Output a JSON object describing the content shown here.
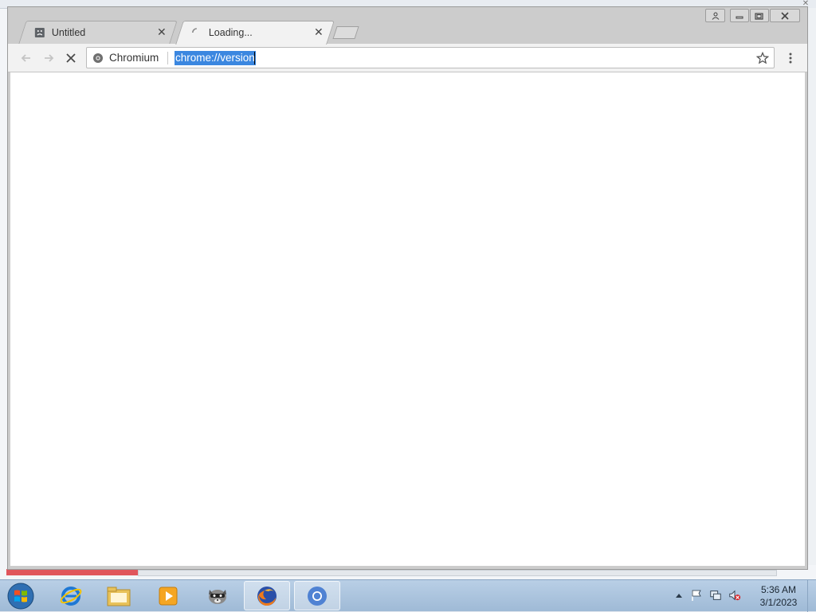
{
  "browser": {
    "tabs": [
      {
        "title": "Untitled",
        "state": "inactive",
        "icon": "sad-document-icon"
      },
      {
        "title": "Loading...",
        "state": "active",
        "icon": "loading-spinner-icon"
      }
    ],
    "toolbar": {
      "site_chip": "Chromium",
      "url": "chrome://version"
    }
  },
  "taskbar": {
    "apps": [
      {
        "name": "Internet Explorer",
        "icon": "internet-explorer-icon"
      },
      {
        "name": "Windows Explorer",
        "icon": "folder-icon"
      },
      {
        "name": "Media Player",
        "icon": "media-player-icon"
      },
      {
        "name": "Raccoon",
        "icon": "raccoon-icon"
      },
      {
        "name": "Firefox",
        "icon": "firefox-icon",
        "active": true
      },
      {
        "name": "Chromium",
        "icon": "chromium-icon",
        "active": true
      }
    ],
    "clock": {
      "time": "5:36 AM",
      "date": "3/1/2023"
    }
  },
  "colors": {
    "selection": "#3b87e0",
    "taskbar": "#b9cfe6",
    "tab_active": "#f2f2f2"
  }
}
